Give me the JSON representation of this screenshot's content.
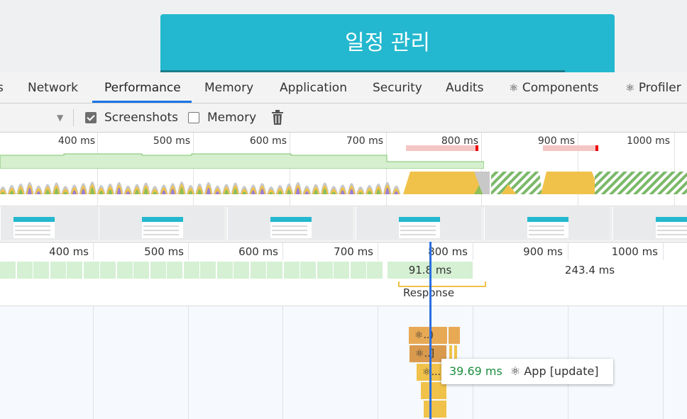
{
  "app": {
    "title": "일정 관리"
  },
  "tabs": [
    {
      "label": "s"
    },
    {
      "label": "Network"
    },
    {
      "label": "Performance"
    },
    {
      "label": "Memory"
    },
    {
      "label": "Application"
    },
    {
      "label": "Security"
    },
    {
      "label": "Audits"
    },
    {
      "label": "Components",
      "icon": "react-icon"
    },
    {
      "label": "Profiler",
      "icon": "react-icon"
    }
  ],
  "active_tab": "Performance",
  "toolbar": {
    "screenshots_label": "Screenshots",
    "screenshots_checked": true,
    "memory_label": "Memory",
    "memory_checked": false,
    "dropdown_icon": "triangle-down-icon",
    "trash_icon": "trash-icon"
  },
  "overview": {
    "tick_labels": [
      "400 ms",
      "500 ms",
      "600 ms",
      "700 ms",
      "800 ms",
      "900 ms",
      "1000 ms"
    ]
  },
  "timeline": {
    "tick_labels": [
      "400 ms",
      "500 ms",
      "600 ms",
      "700 ms",
      "800 ms",
      "900 ms",
      "1000 ms"
    ],
    "frame_labels": [
      "91.8 ms",
      "243.4 ms"
    ],
    "interaction_label": "Response",
    "flame_labels": [
      "..)",
      "..]",
      "..."
    ]
  },
  "tooltip": {
    "duration": "39.69 ms",
    "name": "App [update]"
  },
  "colors": {
    "brand": "#23b8cf",
    "accent": "#1a73e8",
    "frame_green": "#d5f0d3",
    "scripting_yellow": "#f0c24a",
    "tooltip_green": "#1e8e3e"
  }
}
